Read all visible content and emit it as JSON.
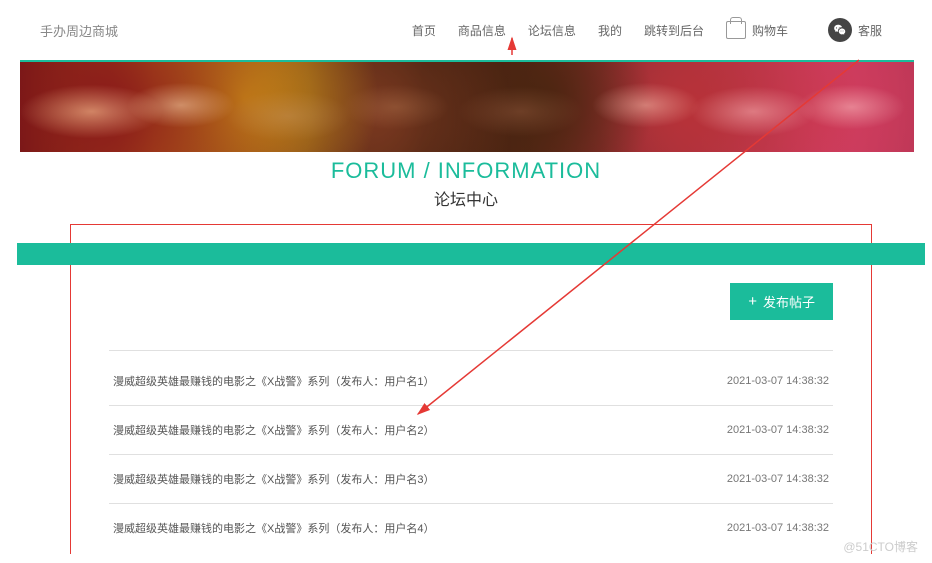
{
  "header": {
    "logo": "手办周边商城",
    "nav": {
      "home": "首页",
      "goods": "商品信息",
      "forum": "论坛信息",
      "mine": "我的",
      "admin": "跳转到后台"
    },
    "cart_label": "购物车",
    "wechat_label": "客服"
  },
  "title": {
    "en": "FORUM / INFORMATION",
    "zh": "论坛中心"
  },
  "publish_button": "发布帖子",
  "threads": [
    {
      "title": "漫威超级英雄最赚钱的电影之《X战警》系列（发布人：用户名1）",
      "time": "2021-03-07 14:38:32"
    },
    {
      "title": "漫威超级英雄最赚钱的电影之《X战警》系列（发布人：用户名2）",
      "time": "2021-03-07 14:38:32"
    },
    {
      "title": "漫威超级英雄最赚钱的电影之《X战警》系列（发布人：用户名3）",
      "time": "2021-03-07 14:38:32"
    },
    {
      "title": "漫威超级英雄最赚钱的电影之《X战警》系列（发布人：用户名4）",
      "time": "2021-03-07 14:38:32"
    }
  ],
  "watermark": "@51CTO博客",
  "colors": {
    "accent": "#1BBC9B",
    "annotation": "#E53935"
  }
}
